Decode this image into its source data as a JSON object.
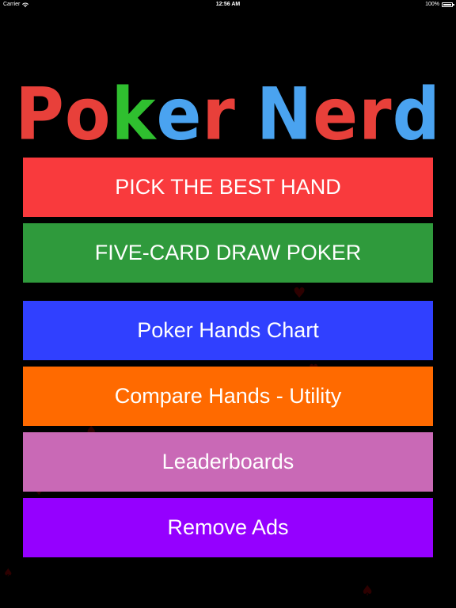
{
  "status_bar": {
    "carrier": "Carrier",
    "time": "12:56 AM",
    "battery": "100%"
  },
  "title": {
    "letters": [
      {
        "char": "P",
        "color": "#e8403a"
      },
      {
        "char": "o",
        "color": "#e8403a"
      },
      {
        "char": "k",
        "color": "#2fbf2f"
      },
      {
        "char": "e",
        "color": "#4aa3f0"
      },
      {
        "char": "r",
        "color": "#e8403a"
      },
      {
        "char": " ",
        "color": "#000000"
      },
      {
        "char": "N",
        "color": "#4aa3f0"
      },
      {
        "char": "e",
        "color": "#e8403a"
      },
      {
        "char": "r",
        "color": "#e8403a"
      },
      {
        "char": "d",
        "color": "#4aa3f0"
      }
    ]
  },
  "menu": [
    {
      "label": "PICK THE BEST HAND",
      "color": "#f93a3d"
    },
    {
      "label": "FIVE-CARD DRAW POKER",
      "color": "#2f9a3c"
    },
    {
      "label": "Poker Hands Chart",
      "color": "#3040ff"
    },
    {
      "label": "Compare Hands - Utility",
      "color": "#ff6a00"
    },
    {
      "label": "Leaderboards",
      "color": "#c969b6"
    },
    {
      "label": "Remove Ads",
      "color": "#9500ff"
    }
  ]
}
